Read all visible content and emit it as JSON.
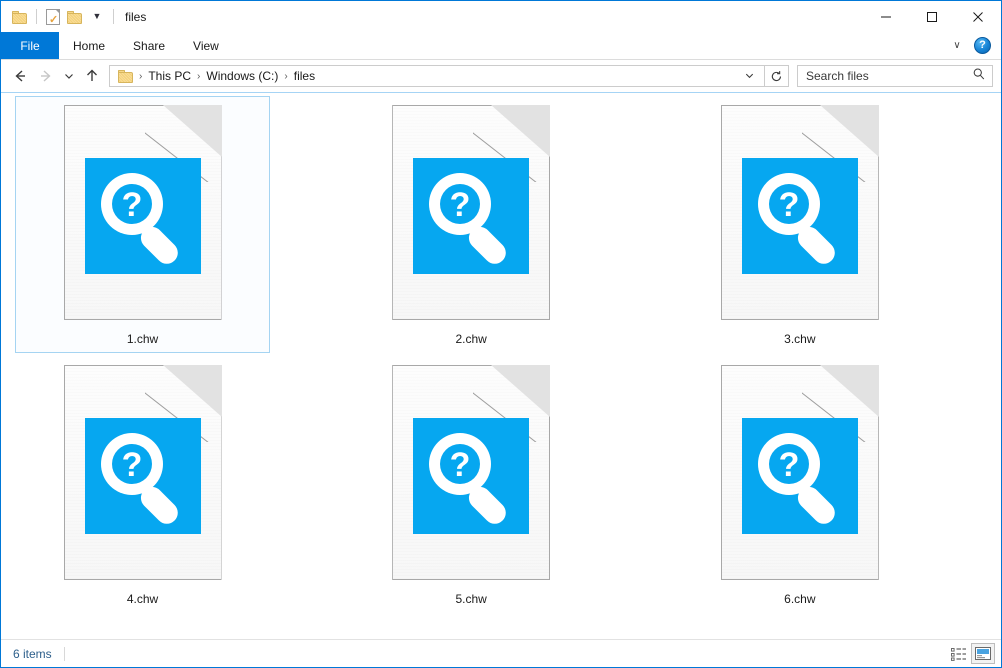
{
  "window": {
    "title": "files",
    "quick_access": [
      {
        "name": "folder-icon",
        "label": "Folder"
      },
      {
        "name": "properties-icon",
        "label": "Properties"
      },
      {
        "name": "folder-icon-2",
        "label": "Folder"
      },
      {
        "name": "customize-chevron",
        "label": "▾"
      }
    ],
    "controls": {
      "minimize": "Minimize",
      "maximize": "Maximize",
      "close": "Close"
    }
  },
  "ribbon": {
    "tabs": [
      {
        "label": "File",
        "active_style": "file"
      },
      {
        "label": "Home",
        "active_style": "normal"
      },
      {
        "label": "Share",
        "active_style": "normal"
      },
      {
        "label": "View",
        "active_style": "normal"
      }
    ],
    "expand_chevron": "∨",
    "help_label": "?"
  },
  "address": {
    "back": "←",
    "forward": "→",
    "recent": "∨",
    "up": "↑",
    "crumbs": [
      "This PC",
      "Windows (C:)",
      "files"
    ],
    "separator": "›",
    "dropdown": "∨",
    "refresh": "↻"
  },
  "search": {
    "placeholder": "Search files"
  },
  "files": [
    {
      "name": "1.chw",
      "selected": true
    },
    {
      "name": "2.chw",
      "selected": false
    },
    {
      "name": "3.chw",
      "selected": false
    },
    {
      "name": "4.chw",
      "selected": false
    },
    {
      "name": "5.chw",
      "selected": false
    },
    {
      "name": "6.chw",
      "selected": false
    }
  ],
  "status": {
    "items_text": "6 items",
    "views": [
      {
        "name": "details-view-button",
        "active": false
      },
      {
        "name": "large-icons-view-button",
        "active": true
      }
    ]
  },
  "colors": {
    "accent": "#0078d7",
    "icon_blue": "#06a7f0",
    "selection_border": "#a5d4f2",
    "status_text": "#2d5f8b"
  }
}
